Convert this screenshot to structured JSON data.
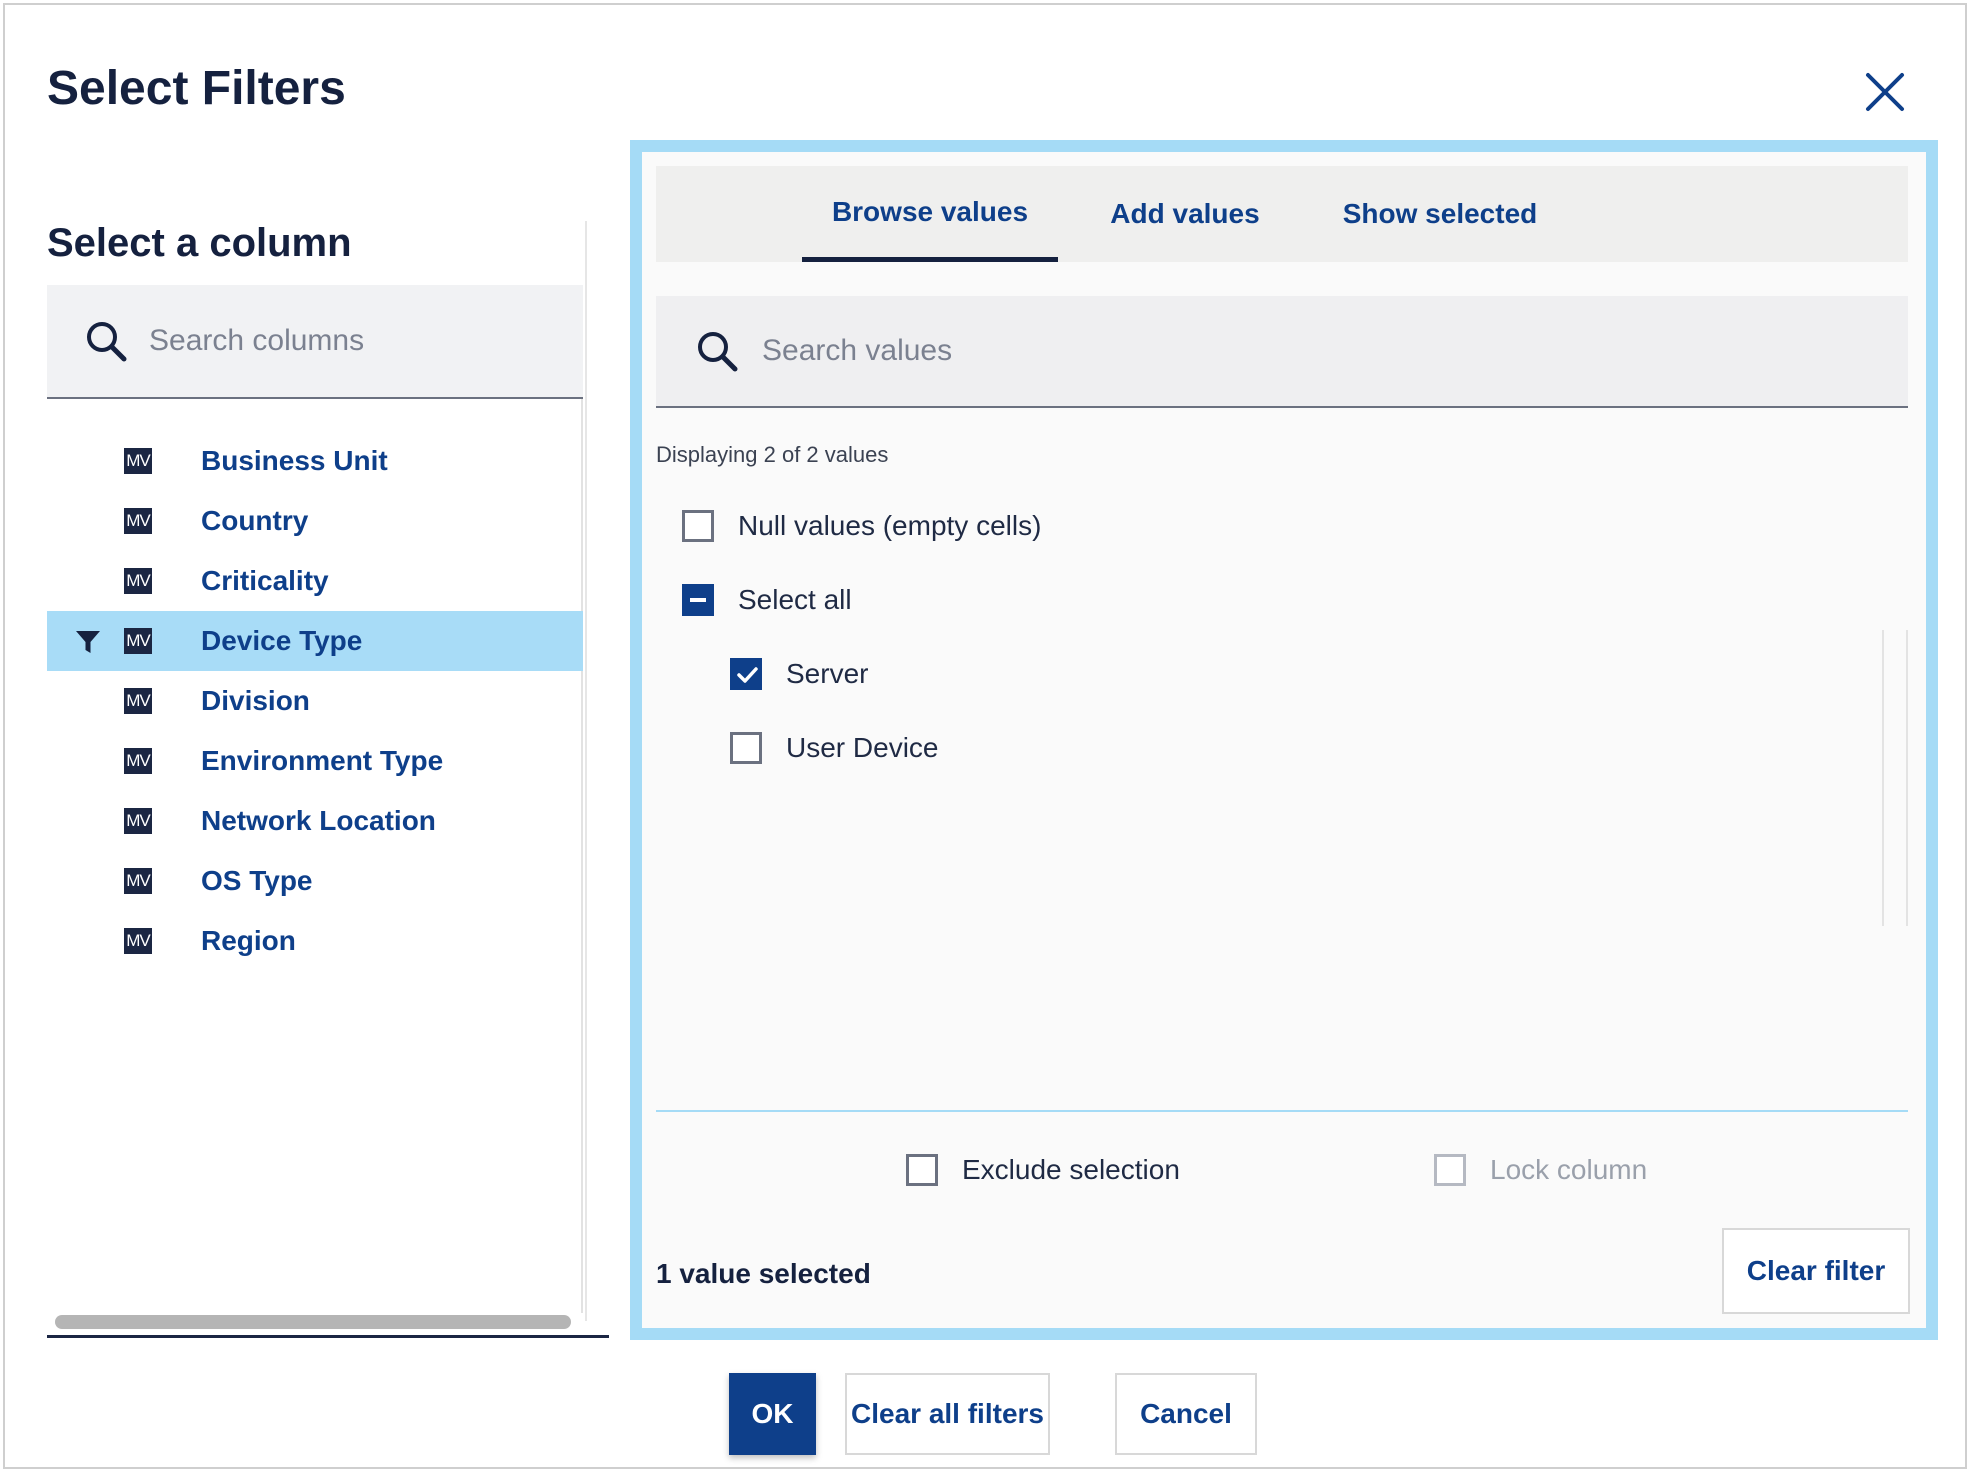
{
  "dialog": {
    "title": "Select Filters",
    "close_icon": "close-icon"
  },
  "columns": {
    "heading": "Select a column",
    "search_placeholder": "Search columns",
    "badge": "MV",
    "items": [
      {
        "label": "Business Unit",
        "selected": false,
        "filtered": false
      },
      {
        "label": "Country",
        "selected": false,
        "filtered": false
      },
      {
        "label": "Criticality",
        "selected": false,
        "filtered": false
      },
      {
        "label": "Device Type",
        "selected": true,
        "filtered": true
      },
      {
        "label": "Division",
        "selected": false,
        "filtered": false
      },
      {
        "label": "Environment Type",
        "selected": false,
        "filtered": false
      },
      {
        "label": "Network Location",
        "selected": false,
        "filtered": false
      },
      {
        "label": "OS Type",
        "selected": false,
        "filtered": false
      },
      {
        "label": "Region",
        "selected": false,
        "filtered": false
      }
    ]
  },
  "values_panel": {
    "tabs": [
      {
        "label": "Browse values",
        "active": true
      },
      {
        "label": "Add values",
        "active": false
      },
      {
        "label": "Show selected",
        "active": false
      }
    ],
    "search_placeholder": "Search values",
    "display_count": "Displaying 2 of 2 values",
    "null_values_label": "Null values (empty cells)",
    "select_all_label": "Select all",
    "values": [
      {
        "label": "Server",
        "checked": true
      },
      {
        "label": "User Device",
        "checked": false
      }
    ],
    "exclude_selection_label": "Exclude selection",
    "lock_column_label": "Lock column",
    "selected_count": "1 value selected",
    "clear_filter_label": "Clear filter"
  },
  "footer": {
    "ok_label": "OK",
    "clear_all_label": "Clear all filters",
    "cancel_label": "Cancel"
  },
  "colors": {
    "accent": "#0e3f8a",
    "highlight": "#a8dcf7",
    "panel_border": "#a5dbf6"
  }
}
